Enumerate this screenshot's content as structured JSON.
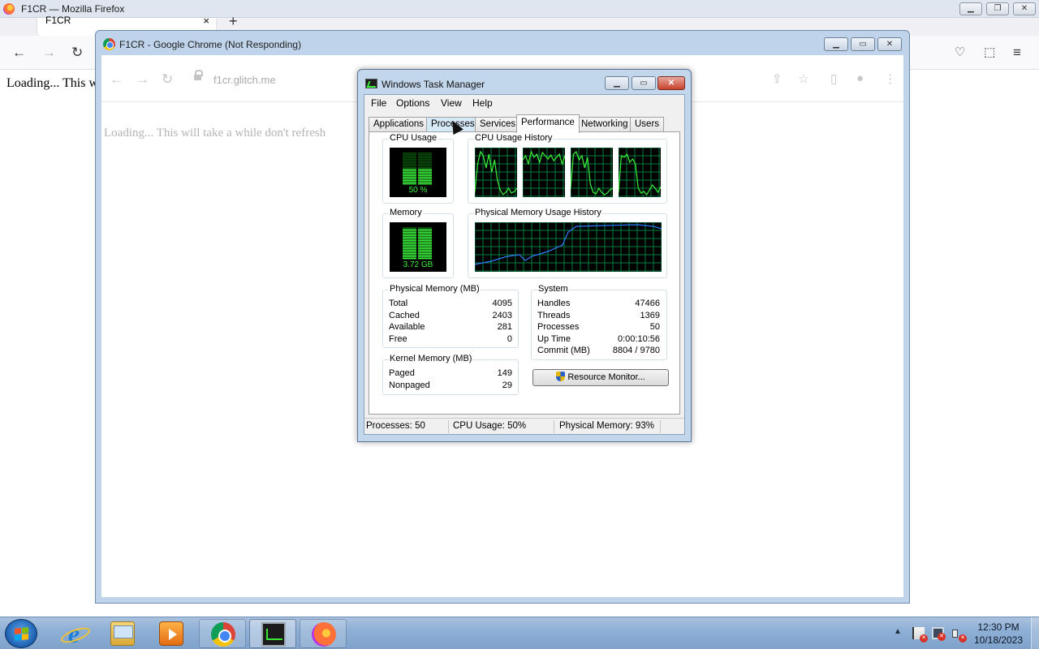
{
  "firefox": {
    "title": "F1CR — Mozilla Firefox",
    "tab_label": "F1CR",
    "tab_close": "×",
    "new_tab": "+",
    "nav": {
      "back": "←",
      "forward": "→",
      "reload": "↻"
    },
    "actions": {
      "pocket": "♡",
      "extensions": "⬚",
      "menu": "≡"
    },
    "content_text": "Loading... This w",
    "window_buttons": {
      "minimize": "▁",
      "restore": "❐",
      "close": "✕"
    }
  },
  "chrome": {
    "title": "F1CR - Google Chrome (Not Responding)",
    "nav": {
      "back": "←",
      "forward": "→",
      "reload": "↻"
    },
    "url": "f1cr.glitch.me",
    "actions": {
      "share": "⇪",
      "bookmark": "☆",
      "side_panel": "▯",
      "profile": "●",
      "menu": "⋮"
    },
    "page_text": "Loading... This will take a while don't refresh",
    "window_buttons": {
      "minimize": "▁",
      "maximize": "▭",
      "close": "✕"
    }
  },
  "task_manager": {
    "title": "Windows Task Manager",
    "window_buttons": {
      "minimize": "▁",
      "maximize": "▭",
      "close": "✕"
    },
    "menu": [
      "File",
      "Options",
      "View",
      "Help"
    ],
    "tabs": [
      "Applications",
      "Processes",
      "Services",
      "Performance",
      "Networking",
      "Users"
    ],
    "active_tab": "Performance",
    "cpu_usage": {
      "label": "CPU Usage",
      "value_text": "50 %",
      "percent": 50
    },
    "cpu_history": {
      "label": "CPU Usage History",
      "cores": 4
    },
    "memory": {
      "label": "Memory",
      "value_text": "3.72 GB",
      "percent": 93
    },
    "memory_history": {
      "label": "Physical Memory Usage History"
    },
    "physical_memory": {
      "label": "Physical Memory (MB)",
      "rows": [
        {
          "k": "Total",
          "v": "4095"
        },
        {
          "k": "Cached",
          "v": "2403"
        },
        {
          "k": "Available",
          "v": "281"
        },
        {
          "k": "Free",
          "v": "0"
        }
      ]
    },
    "kernel_memory": {
      "label": "Kernel Memory (MB)",
      "rows": [
        {
          "k": "Paged",
          "v": "149"
        },
        {
          "k": "Nonpaged",
          "v": "29"
        }
      ]
    },
    "system": {
      "label": "System",
      "rows": [
        {
          "k": "Handles",
          "v": "47466"
        },
        {
          "k": "Threads",
          "v": "1369"
        },
        {
          "k": "Processes",
          "v": "50"
        },
        {
          "k": "Up Time",
          "v": "0:00:10:56"
        },
        {
          "k": "Commit (MB)",
          "v": "8804 / 9780"
        }
      ]
    },
    "resource_monitor_button": "Resource Monitor...",
    "status": {
      "processes": "Processes: 50",
      "cpu": "CPU Usage: 50%",
      "memory": "Physical Memory: 93%"
    }
  },
  "taskbar": {
    "items": [
      "internet-explorer",
      "windows-explorer",
      "media-player",
      "google-chrome",
      "task-manager",
      "firefox"
    ],
    "tray_arrow": "▲",
    "clock_time": "12:30 PM",
    "clock_date": "10/18/2023"
  },
  "colors": {
    "meter_green": "#3cf23c",
    "graph_grid": "#008040",
    "memory_line": "#2f7bff"
  }
}
